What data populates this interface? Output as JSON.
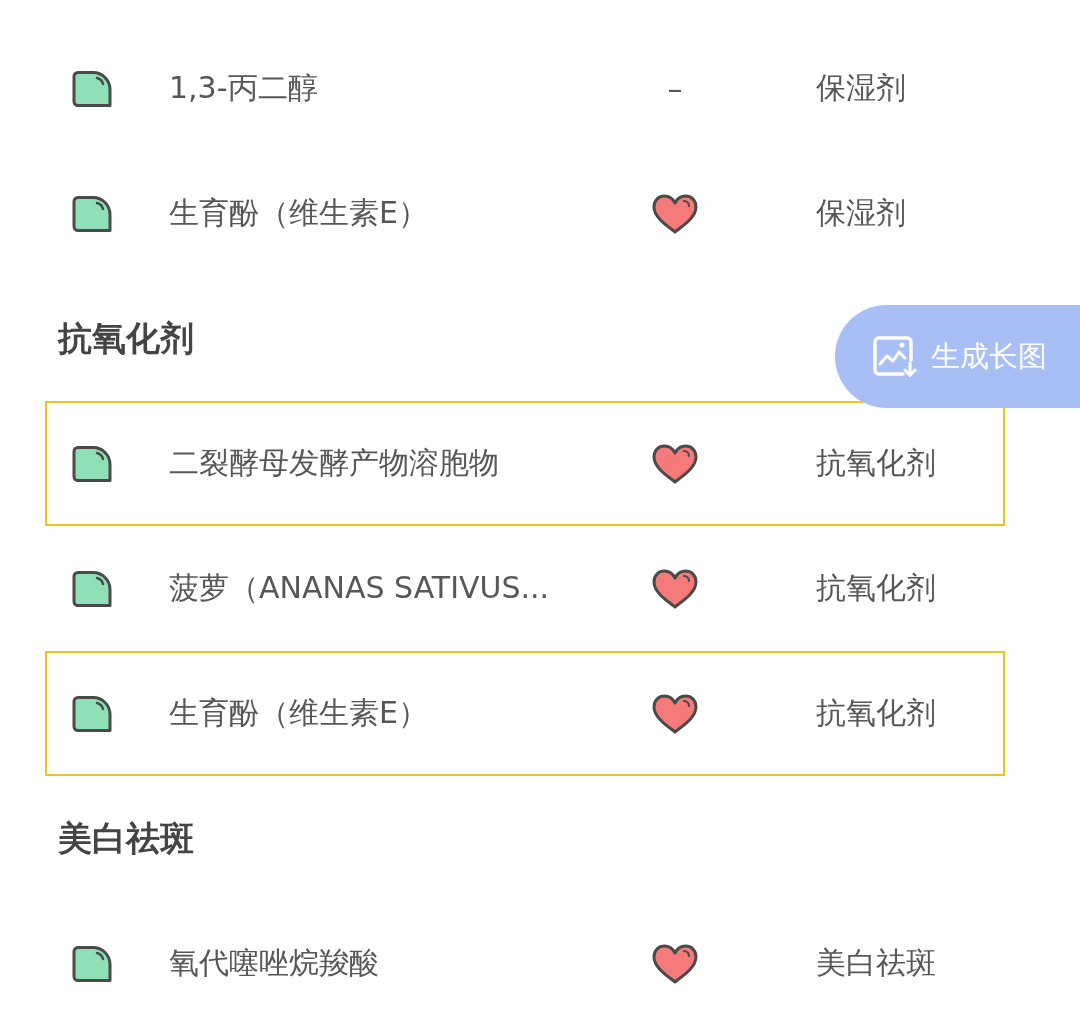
{
  "sections": [
    {
      "rows": [
        {
          "name": "1,3-丙二醇",
          "indicator": {
            "kind": "text",
            "text": "–"
          },
          "effect": "保湿剂",
          "highlighted": false
        },
        {
          "name": "生育酚（维生素E）",
          "indicator": {
            "kind": "heart"
          },
          "effect": "保湿剂",
          "highlighted": false
        }
      ]
    },
    {
      "heading": "抗氧化剂",
      "rows": [
        {
          "name": "二裂酵母发酵产物溶胞物",
          "indicator": {
            "kind": "heart"
          },
          "effect": "抗氧化剂",
          "highlighted": true
        },
        {
          "name": "菠萝（ANANAS SATIVUS...",
          "indicator": {
            "kind": "heart"
          },
          "effect": "抗氧化剂",
          "highlighted": false
        },
        {
          "name": "生育酚（维生素E）",
          "indicator": {
            "kind": "heart"
          },
          "effect": "抗氧化剂",
          "highlighted": true
        }
      ]
    },
    {
      "heading": "美白祛斑",
      "rows": [
        {
          "name": "氧代噻唑烷羧酸",
          "indicator": {
            "kind": "heart"
          },
          "effect": "美白祛斑",
          "highlighted": false
        }
      ]
    }
  ],
  "floating_button": {
    "label": "生成长图"
  }
}
